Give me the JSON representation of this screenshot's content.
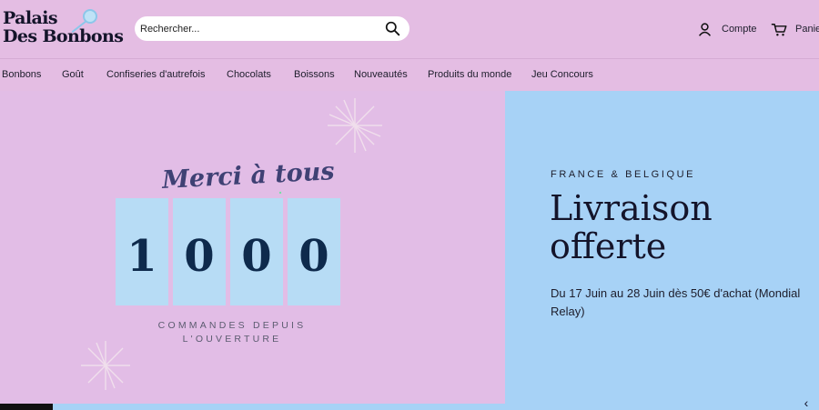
{
  "header": {
    "logo_line1": "Palais",
    "logo_line2": "Des Bonbons",
    "search_placeholder": "Rechercher...",
    "account_label": "Compte",
    "cart_label": "Panie"
  },
  "nav": {
    "items": [
      {
        "label": "Bonbons"
      },
      {
        "label": "Goût"
      },
      {
        "label": "Confiseries d'autrefois"
      },
      {
        "label": "Chocolats"
      },
      {
        "label": "Boissons"
      },
      {
        "label": "Nouveautés"
      },
      {
        "label": "Produits du monde"
      },
      {
        "label": "Jeu Concours"
      }
    ]
  },
  "hero": {
    "merci": "Merci à tous",
    "digits": [
      "1",
      "0",
      "0",
      "0"
    ],
    "subtitle_line1": "COMMANDES DEPUIS",
    "subtitle_line2": "L'OUVERTURE",
    "eyebrow": "FRANCE & BELGIQUE",
    "headline_line1": "Livraison",
    "headline_line2": "offerte",
    "body": "Du 17 Juin au 28 Juin dès 50€ d'achat (Mondial Relay)",
    "prev_arrow": "‹"
  },
  "colors": {
    "page_bg": "#e4bde3",
    "hero_right_bg": "#a7d2f6",
    "digit_box": "#b7dcf5",
    "digit_text": "#0e2a4c"
  },
  "icons": {
    "search": "search-icon",
    "account": "user-icon",
    "cart": "cart-icon",
    "prev": "chevron-left-icon"
  }
}
